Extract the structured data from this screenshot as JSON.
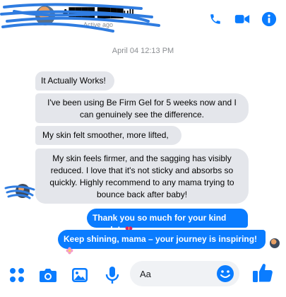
{
  "header": {
    "contact_name": "A████ ████ull",
    "status": "Active ago",
    "actions": [
      "phone-call",
      "video-call",
      "conversation-info"
    ]
  },
  "colors": {
    "accent": "#0a7cff",
    "incoming_bubble": "#e4e6eb",
    "heart": "#e0245e"
  },
  "conversation": {
    "timestamp": "April 04 12:13 PM",
    "incoming": [
      "It Actually Works!",
      "I've been using Be Firm Gel for 5 weeks now and I can genuinely see the difference.",
      "My skin felt smoother, more lifted,",
      "My skin feels firmer, and the sagging has visibly reduced. I love that it's not sticky and absorbs so quickly. Highly recommend to any mama trying to bounce back after baby!"
    ],
    "outgoing": [
      {
        "text": "Thank you so much for your kind words!",
        "emoji": "heart-gift"
      },
      {
        "text": "Keep shining, mama – your journey is inspiring!",
        "emoji": "pink-flower"
      }
    ]
  },
  "composer": {
    "placeholder": "Aa",
    "icons": [
      "more-actions-icon",
      "camera-icon",
      "image-icon",
      "microphone-icon",
      "emoji-icon",
      "thumbs-up-icon"
    ]
  }
}
